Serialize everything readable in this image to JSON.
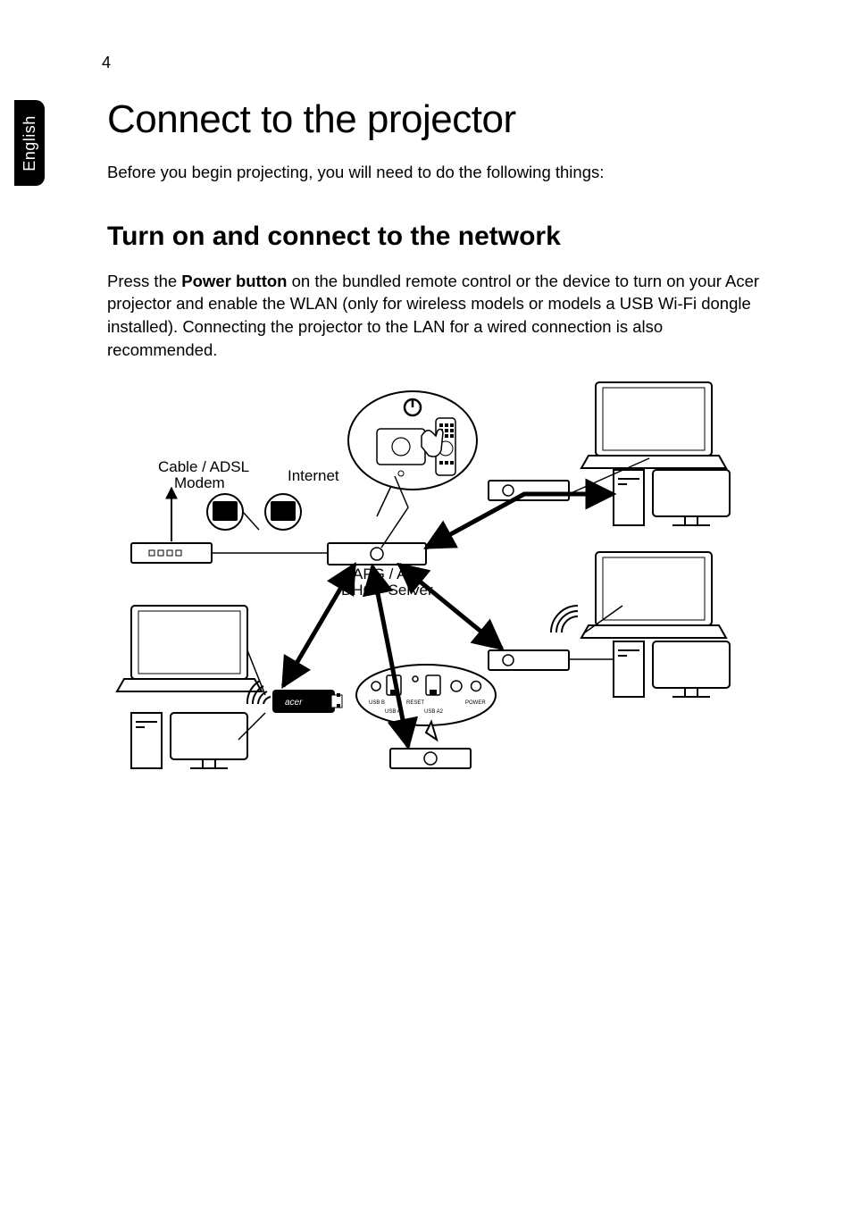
{
  "page_number": "4",
  "side_tab": "English",
  "heading": "Connect to the projector",
  "intro": "Before you begin projecting, you will need to do the following things:",
  "subheading": "Turn on and connect to the network",
  "body_prefix": "Press the ",
  "body_bold": "Power button",
  "body_suffix": " on the bundled remote control or the device to turn on your Acer projector and enable the WLAN (only for wireless models or models a USB Wi-Fi dongle installed). Connecting the projector to the LAN for a wired connection is also recommended.",
  "diagram": {
    "label_cable": "Cable / ADSL",
    "label_modem": "Modem",
    "label_internet": "Internet",
    "label_apg": "APG / AP",
    "label_dhcp": "DHCP Server",
    "dongle_brand": "acer",
    "port_usb_b": "USB B",
    "port_reset": "RESET",
    "port_power": "POWER",
    "port_usb_a1": "USB A1",
    "port_usb_a2": "USB A2"
  }
}
